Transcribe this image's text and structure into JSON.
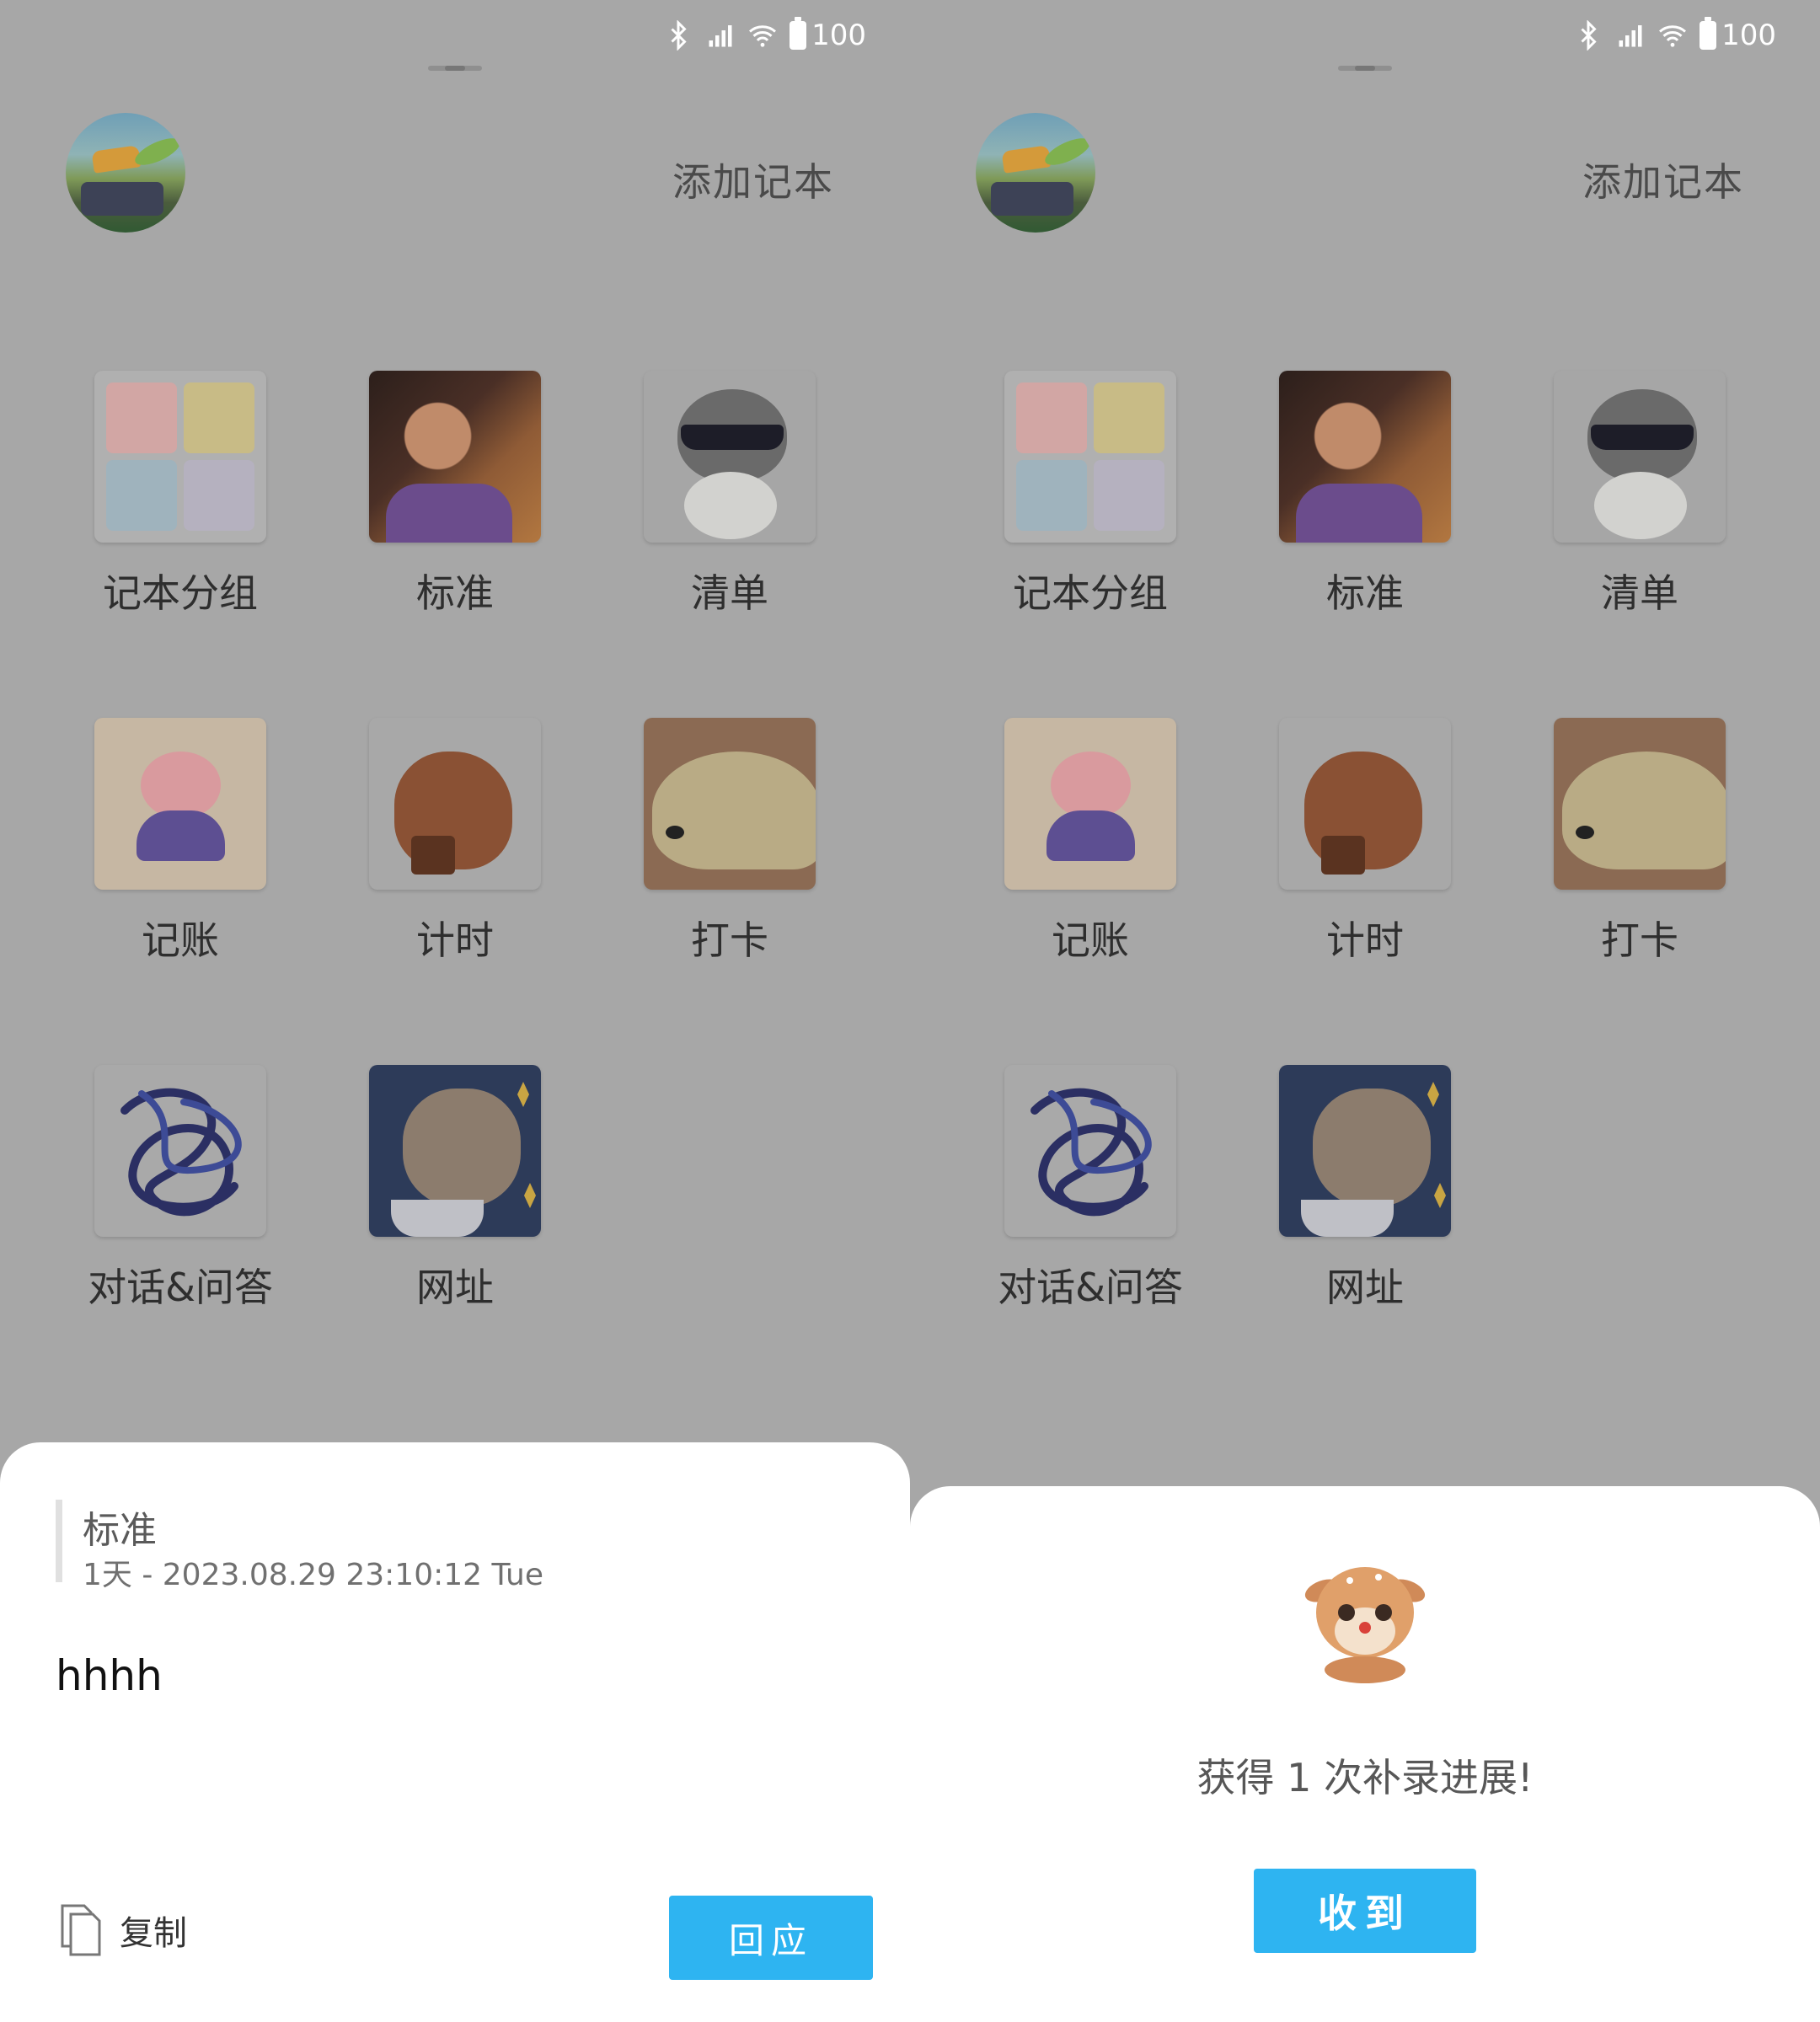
{
  "status": {
    "battery": "100"
  },
  "header": {
    "add_notebook": "添加记本"
  },
  "grid": {
    "items": [
      {
        "label": "记本分组",
        "icon": "notebook-group-icon"
      },
      {
        "label": "标准",
        "icon": "standard-icon"
      },
      {
        "label": "清单",
        "icon": "checklist-icon"
      },
      {
        "label": "记账",
        "icon": "accounting-icon"
      },
      {
        "label": "计时",
        "icon": "timer-icon"
      },
      {
        "label": "打卡",
        "icon": "check-in-icon"
      },
      {
        "label": "对话&问答",
        "icon": "chat-icon"
      },
      {
        "label": "网址",
        "icon": "url-icon"
      }
    ]
  },
  "entry_sheet": {
    "title": "标准",
    "meta": "1天 - 2023.08.29 23:10:12 Tue",
    "body": "hhhh",
    "copy_label": "复制",
    "reply_label": "回应"
  },
  "reward_sheet": {
    "message": "获得 1 次补录进展!",
    "receive_label": "收到"
  },
  "colors": {
    "accent": "#2eb4f1",
    "overlay": "#a7a7a7",
    "sheet": "#ffffff"
  }
}
